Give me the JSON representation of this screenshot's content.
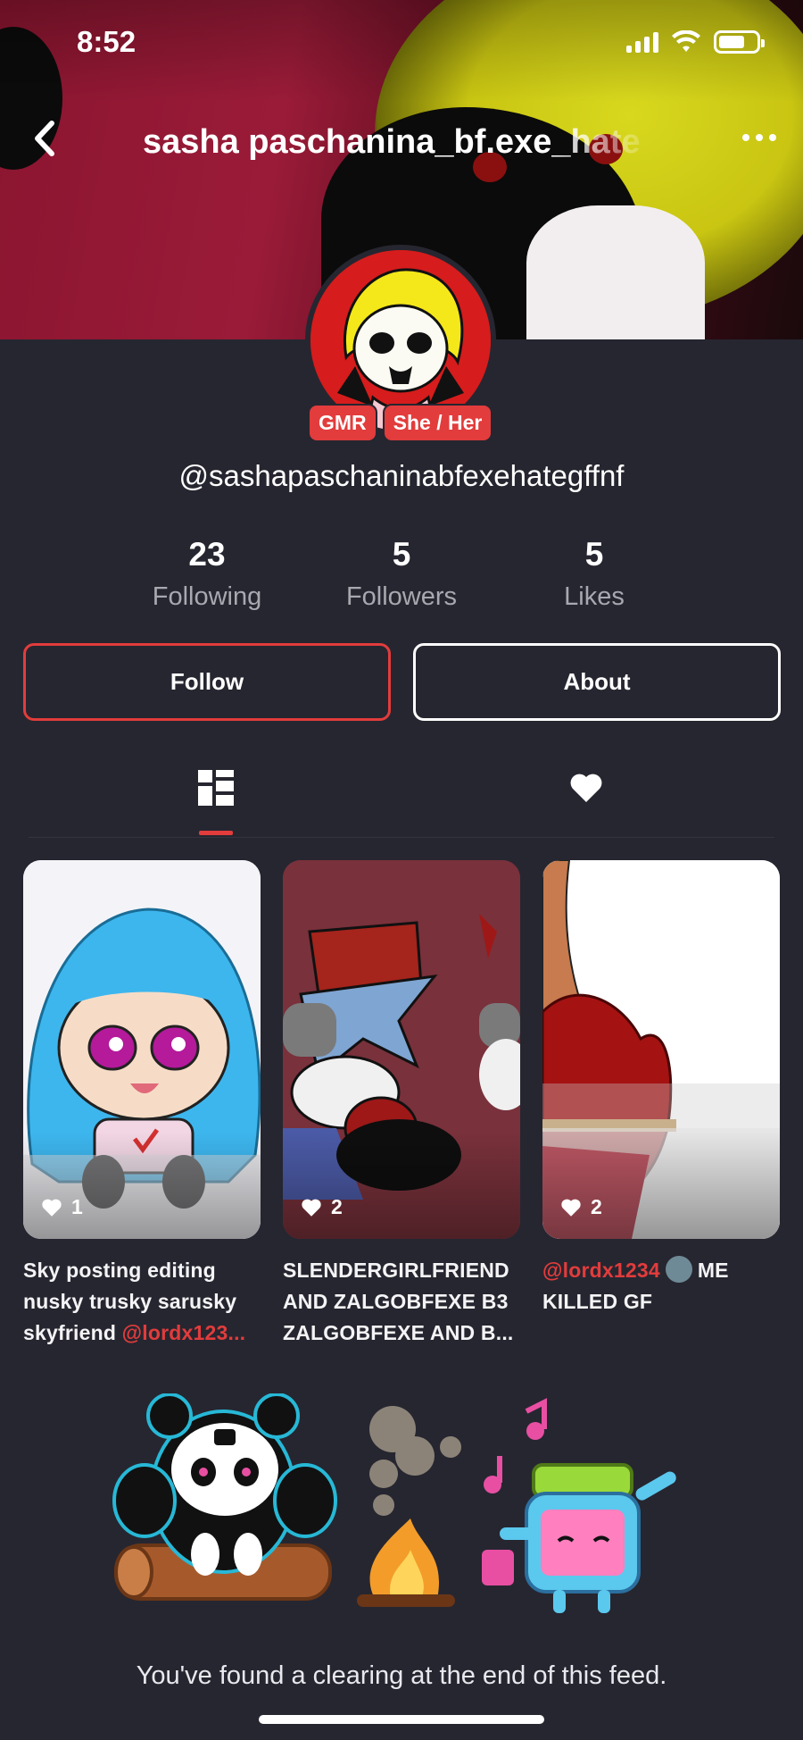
{
  "status_bar": {
    "time": "8:52"
  },
  "header": {
    "title": "sasha paschanina_bf.exe_hate",
    "back_icon": "chevron-left-icon",
    "more_icon": "more-horizontal-icon"
  },
  "profile": {
    "badges": [
      "GMR",
      "She / Her"
    ],
    "handle": "@sashapaschaninabfexehategffnf",
    "stats": [
      {
        "value": "23",
        "label": "Following"
      },
      {
        "value": "5",
        "label": "Followers"
      },
      {
        "value": "5",
        "label": "Likes"
      }
    ],
    "follow_label": "Follow",
    "about_label": "About"
  },
  "tabs": [
    {
      "icon": "grid-icon",
      "active": true
    },
    {
      "icon": "heart-icon",
      "active": false
    }
  ],
  "posts": [
    {
      "likes": "1",
      "caption_lines": [
        "Sky posting editing",
        "nusky trusky sarusky",
        "skyfriend "
      ],
      "mention": "@lordx123..."
    },
    {
      "likes": "2",
      "caption_lines": [
        "SLENDERGIRLFRIEND",
        "AND ZALGOBFEXE B3",
        "ZALGOBFEXE AND B..."
      ]
    },
    {
      "likes": "2",
      "mention": "@lordx1234",
      "caption_after_mention": "ME",
      "caption_line2": "KILLED GF"
    }
  ],
  "end_message": "You've found a clearing at the end of this feed.",
  "colors": {
    "accent": "#e23c3c",
    "background": "#262630",
    "muted_text": "#a8a8b0"
  }
}
